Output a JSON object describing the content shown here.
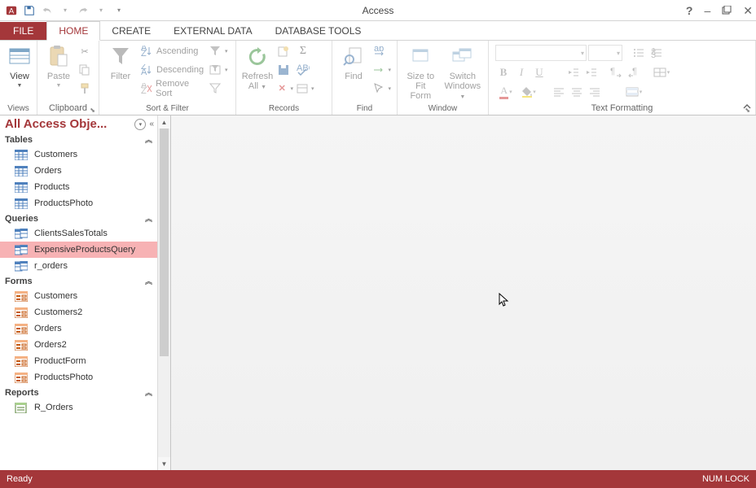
{
  "app": {
    "title": "Access"
  },
  "window": {
    "help": "?",
    "min": "—",
    "max": "❐",
    "close": "✕"
  },
  "tabs": {
    "file": "FILE",
    "home": "HOME",
    "create": "CREATE",
    "external": "EXTERNAL DATA",
    "dbtools": "DATABASE TOOLS"
  },
  "ribbon": {
    "views": {
      "view": "View",
      "group": "Views"
    },
    "clipboard": {
      "paste": "Paste",
      "group": "Clipboard"
    },
    "sortfilter": {
      "filter": "Filter",
      "asc": "Ascending",
      "desc": "Descending",
      "remove": "Remove Sort",
      "group": "Sort & Filter"
    },
    "records": {
      "refresh": "Refresh All",
      "group": "Records"
    },
    "find": {
      "find": "Find",
      "group": "Find"
    },
    "window": {
      "size": "Size to Fit Form",
      "switch": "Switch Windows",
      "group": "Window"
    },
    "format": {
      "group": "Text Formatting"
    }
  },
  "nav": {
    "title": "All Access Obje...",
    "sections": {
      "tables": "Tables",
      "queries": "Queries",
      "forms": "Forms",
      "reports": "Reports"
    },
    "tables": [
      "Customers",
      "Orders",
      "Products",
      "ProductsPhoto"
    ],
    "queries": [
      "ClientsSalesTotals",
      "ExpensiveProductsQuery",
      "r_orders"
    ],
    "forms": [
      "Customers",
      "Customers2",
      "Orders",
      "Orders2",
      "ProductForm",
      "ProductsPhoto"
    ],
    "reports": [
      "R_Orders"
    ],
    "selected": "ExpensiveProductsQuery"
  },
  "status": {
    "ready": "Ready",
    "numlock": "NUM LOCK"
  }
}
